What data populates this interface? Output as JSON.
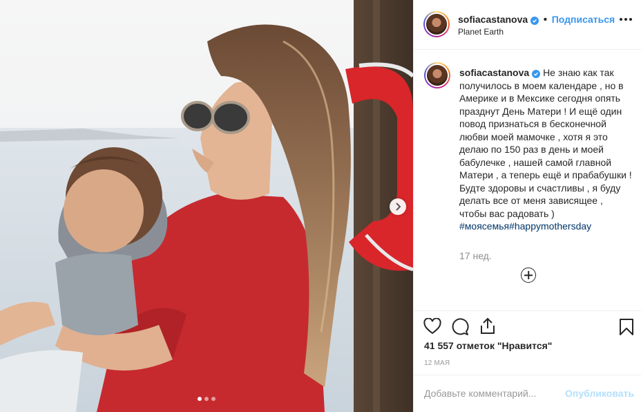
{
  "post": {
    "username": "sofiacastanova",
    "follow_label": "Подписаться",
    "separator": "•",
    "location": "Planet Earth",
    "caption": "Не знаю как так получилось в моем календаре , но в Америке и в Мексике сегодня опять празднут День Матери ! И ещё один повод признаться в бесконечной любви моей мамочке , хотя я это делаю по 150 раз в день и моей бабулечке , нашей самой главной Матери , а теперь ещё и прабабушки ! Будте здоровы и счастливы , я буду делать все от меня зависящее , чтобы вас радовать )",
    "hashtags": [
      "#моясемья",
      "#happymothersday"
    ],
    "time_ago": "17 нед.",
    "likes_text": "41 557 отметок \"Нравится\"",
    "date": "12 МАЯ",
    "comment_placeholder": "Добавьте комментарий...",
    "publish_label": "Опубликовать"
  },
  "carousel": {
    "slide_count": 3,
    "active_slide": 1
  },
  "icons": {
    "more": "more-options-icon",
    "verified": "verified-badge-icon",
    "like": "heart-icon",
    "comment": "comment-icon",
    "share": "share-icon",
    "save": "bookmark-icon",
    "next": "chevron-right-icon",
    "load_more": "plus-circle-icon"
  },
  "colors": {
    "link": "#3897f0",
    "hashtag": "#003569",
    "muted": "#8e8e8e",
    "publish_disabled": "#b2dffc"
  }
}
